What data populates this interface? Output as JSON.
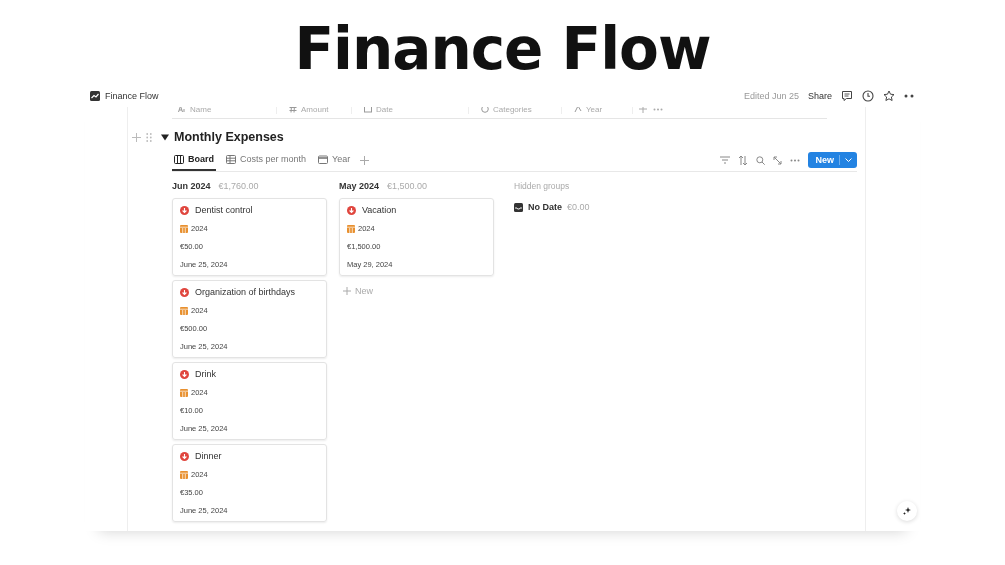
{
  "title": "Finance Flow",
  "topbar": {
    "page_title": "Finance Flow",
    "edited": "Edited Jun 25",
    "share": "Share"
  },
  "table_columns": [
    {
      "label": "Name",
      "kind": "text"
    },
    {
      "label": "Amount",
      "kind": "number"
    },
    {
      "label": "Date",
      "kind": "date"
    },
    {
      "label": "Categories",
      "kind": "relation"
    },
    {
      "label": "Year",
      "kind": "formula"
    }
  ],
  "section": {
    "title": "Monthly Expenses",
    "expanded": true
  },
  "views": [
    {
      "label": "Board",
      "kind": "board",
      "selected": true
    },
    {
      "label": "Costs per month",
      "kind": "table",
      "selected": false
    },
    {
      "label": "Year",
      "kind": "calendar",
      "selected": false
    }
  ],
  "new_button": "New",
  "groups": [
    {
      "title": "Jun 2024",
      "total": "€1,760.00",
      "cards": [
        {
          "name": "Dentist control",
          "year": "2024",
          "amount": "€50.00",
          "date": "June 25, 2024"
        },
        {
          "name": "Organization of birthdays",
          "year": "2024",
          "amount": "€500.00",
          "date": "June 25, 2024"
        },
        {
          "name": "Drink",
          "year": "2024",
          "amount": "€10.00",
          "date": "June 25, 2024"
        },
        {
          "name": "Dinner",
          "year": "2024",
          "amount": "€35.00",
          "date": "June 25, 2024"
        }
      ]
    },
    {
      "title": "May 2024",
      "total": "€1,500.00",
      "add_label": "New",
      "cards": [
        {
          "name": "Vacation",
          "year": "2024",
          "amount": "€1,500.00",
          "date": "May 29, 2024"
        }
      ]
    }
  ],
  "hidden_groups": {
    "label": "Hidden groups",
    "items": [
      {
        "title": "No Date",
        "total": "€0.00"
      }
    ]
  }
}
